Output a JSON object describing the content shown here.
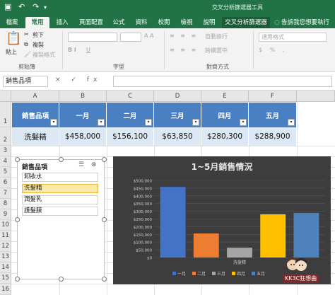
{
  "titlebar": {
    "context_title": "交叉分析篩選器工具"
  },
  "tabs": [
    "檔案",
    "常用",
    "插入",
    "頁面配置",
    "公式",
    "資料",
    "校閱",
    "檢視",
    "說明",
    "交叉分析篩選器",
    "告訴我您想要執行"
  ],
  "ribbon": {
    "paste": "貼上",
    "cut": "剪下",
    "copy": "複製",
    "format_painter": "複製格式",
    "clipboard_label": "剪貼簿",
    "font_label": "字型",
    "align_label": "對齊方式",
    "auto_wrap": "自動換行",
    "merge_center": "跨欄置中",
    "number_format": "通用格式",
    "font_size_up": "A A",
    "underline": "U",
    "bold_italic": "B I"
  },
  "formula_bar": {
    "name_box": "銷售品項",
    "fx_buttons": "× ✓ fx"
  },
  "columns": [
    "A",
    "B",
    "C",
    "D",
    "E",
    "F"
  ],
  "rows": [
    "1",
    "2",
    "3",
    "4",
    "5",
    "6",
    "7",
    "8",
    "9",
    "10",
    "11",
    "12",
    "13",
    "14",
    "15",
    "16"
  ],
  "table": {
    "headers": [
      "銷售品項",
      "一月",
      "二月",
      "三月",
      "四月",
      "五月"
    ],
    "row": [
      "洗髮精",
      "$458,000",
      "$156,100",
      "$63,850",
      "$280,300",
      "$288,900"
    ]
  },
  "slicer": {
    "title": "銷售品項",
    "items": [
      "卸妝水",
      "洗髮精",
      "潤髮乳",
      "護髮膜"
    ],
    "selected_index": 1
  },
  "chart_data": {
    "type": "bar",
    "title": "1~5月銷售情況",
    "categories": [
      "洗髮精"
    ],
    "series": [
      {
        "name": "一月",
        "values": [
          458000
        ],
        "color": "#4472c4"
      },
      {
        "name": "二月",
        "values": [
          156100
        ],
        "color": "#ed7d31"
      },
      {
        "name": "三月",
        "values": [
          63850
        ],
        "color": "#a5a5a5"
      },
      {
        "name": "四月",
        "values": [
          280300
        ],
        "color": "#ffc000"
      },
      {
        "name": "五月",
        "values": [
          288900
        ],
        "color": "#4f81bd"
      }
    ],
    "ylim": [
      0,
      500000
    ],
    "yticks": [
      "$0",
      "$50,000",
      "$100,000",
      "$150,000",
      "$200,000",
      "$250,000",
      "$300,000",
      "$350,000",
      "$400,000",
      "$450,000",
      "$500,000"
    ],
    "legend": "bottom",
    "grid": true
  },
  "watermark": "KK3C狂想曲",
  "colors": {
    "excel_green": "#217346",
    "header_blue": "#4a7fc1",
    "row_fill": "#dde8f5"
  }
}
